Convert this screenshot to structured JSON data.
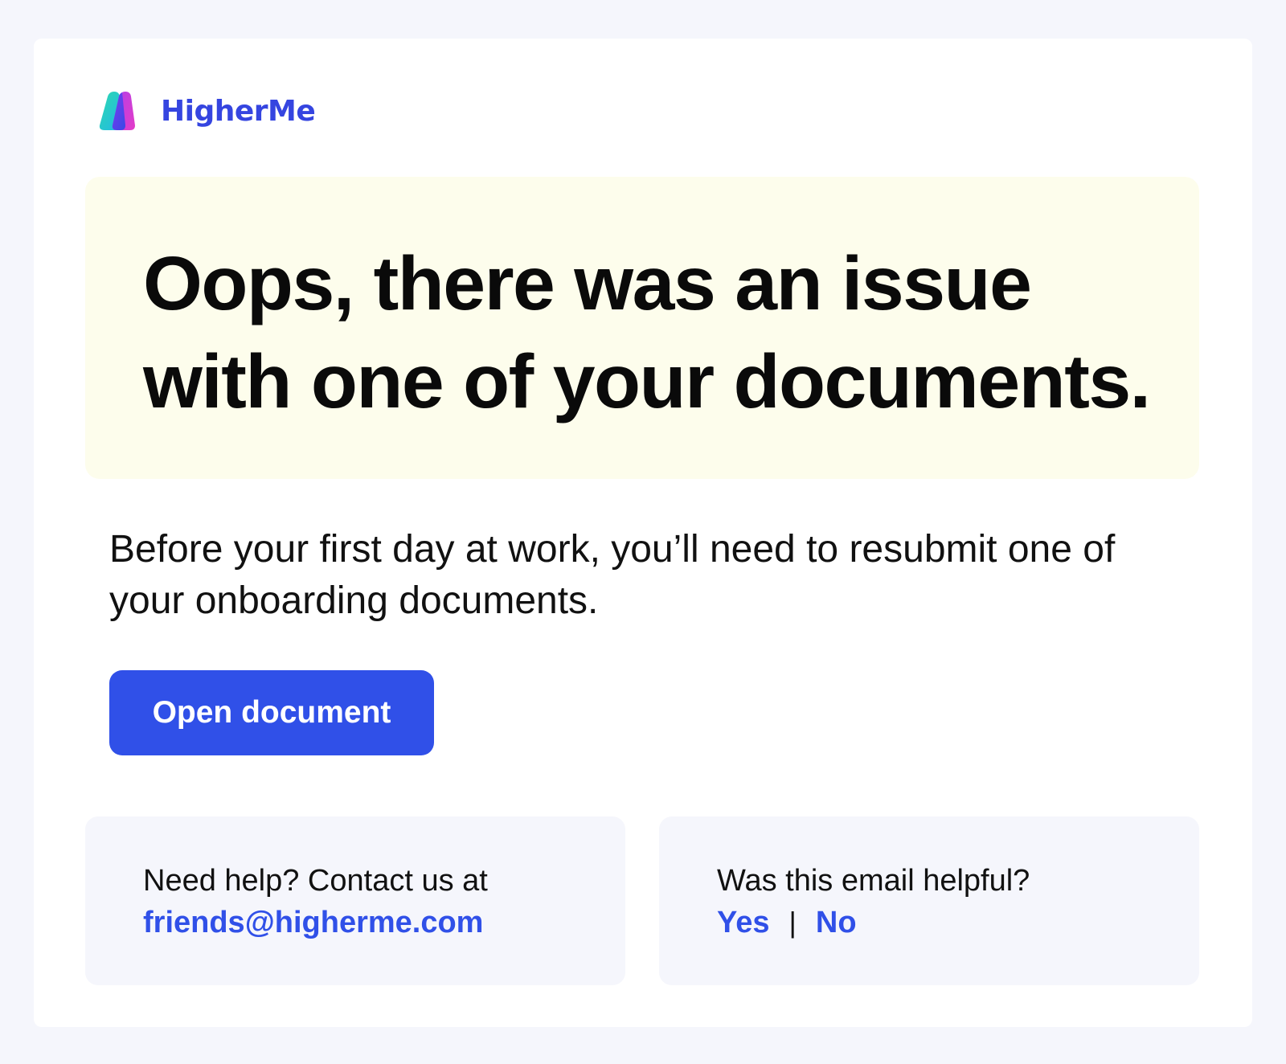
{
  "brand": {
    "name": "HigherMe",
    "logo_icon": "higherme-logo-icon",
    "color": "#3545e0"
  },
  "hero": {
    "headline": "Oops, there was an issue with one of your documents.",
    "background": "#fdfdec"
  },
  "message": {
    "body": "Before your first day at work, you’ll need to resubmit one of your onboarding documents."
  },
  "cta": {
    "label": "Open document",
    "color": "#3050e8"
  },
  "help": {
    "prompt": "Need help? Contact us at",
    "email": "friends@higherme.com"
  },
  "feedback": {
    "question": "Was this email helpful?",
    "yes_label": "Yes",
    "separator": "|",
    "no_label": "No"
  }
}
